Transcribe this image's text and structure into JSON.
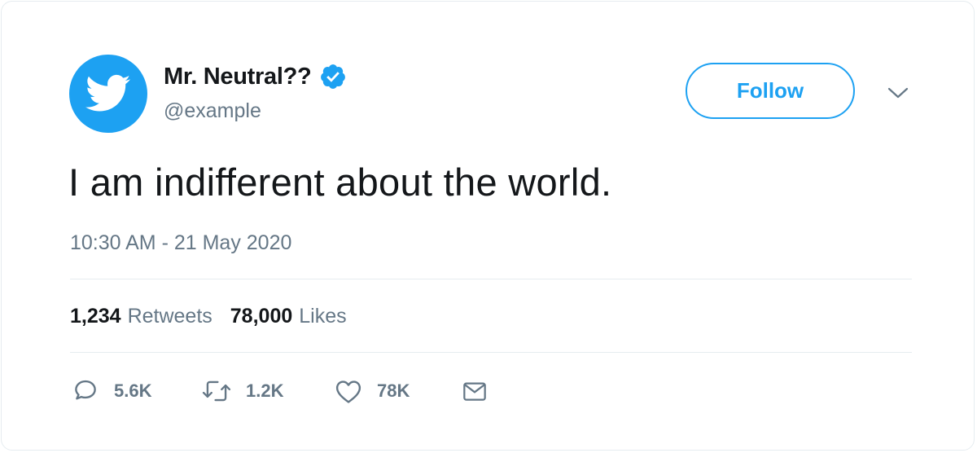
{
  "tweet": {
    "display_name": "Mr. Neutral??",
    "handle": "@example",
    "follow_label": "Follow",
    "text": "I am indifferent about the world.",
    "timestamp": "10:30 AM - 21 May 2020",
    "stats": {
      "retweets_count": "1,234",
      "retweets_label": "Retweets",
      "likes_count": "78,000",
      "likes_label": "Likes"
    },
    "actions": {
      "reply_count": "5.6K",
      "retweet_count": "1.2K",
      "like_count": "78K"
    },
    "icons": {
      "avatar": "twitter-bird-icon",
      "verified": "verified-badge-icon",
      "menu": "chevron-down-icon",
      "reply": "reply-icon",
      "retweet": "retweet-icon",
      "like": "heart-icon",
      "share": "envelope-icon"
    },
    "colors": {
      "accent": "#1da1f2",
      "text_primary": "#14171a",
      "text_secondary": "#657786",
      "divider": "#e6ecf0"
    }
  }
}
